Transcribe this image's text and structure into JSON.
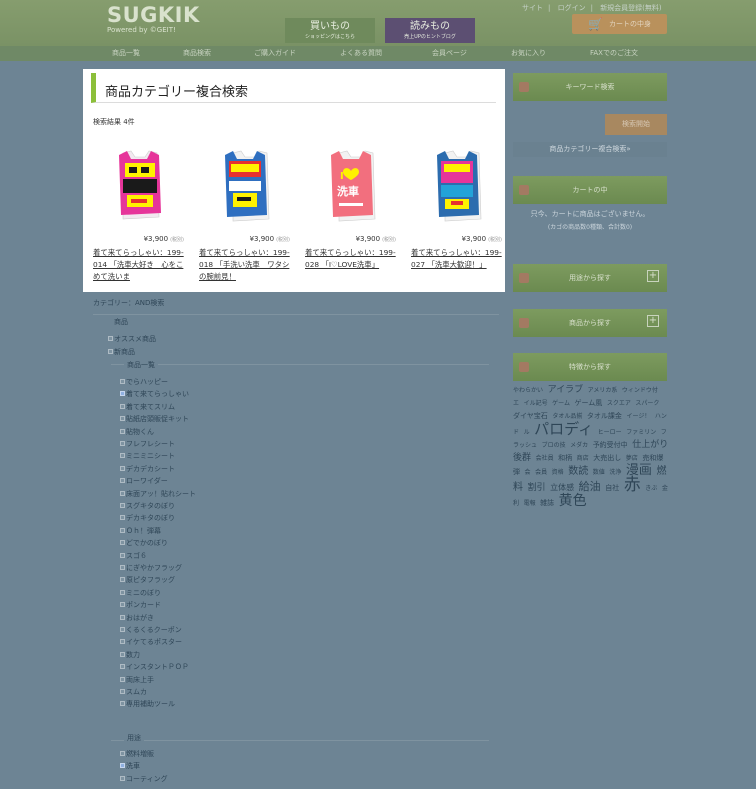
{
  "header": {
    "logo": "SUGKIK",
    "logo_sub": "Powered by ©GEIT!",
    "buy_label": "買いもの",
    "buy_sub": "ショッピングはこちら",
    "read_label": "読みもの",
    "read_sub": "売上UPのヒントブログ",
    "toplinks": [
      "サイト",
      "ログイン",
      "新規会員登録(無料)"
    ],
    "cart_label": "カートの中身"
  },
  "nav": [
    "商品一覧",
    "商品検索",
    "ご購入ガイド",
    "よくある質問",
    "会員ページ",
    "お気に入り",
    "FAXでのご注文"
  ],
  "main": {
    "title": "商品カテゴリー複合検索",
    "count": "検索結果 4件",
    "products": [
      {
        "price": "¥3,900",
        "tax": "(税別)",
        "name": "着て来てらっしゃい：199-014 「洗車大好き　心をこめて洗いま"
      },
      {
        "price": "¥3,900",
        "tax": "(税別)",
        "name": "着て来てらっしゃい：199-018 「手洗い洗車　ワタシの腕前見！"
      },
      {
        "price": "¥3,900",
        "tax": "(税別)",
        "name": "着て来てらっしゃい：199-028 「I♡LOVE洗車」"
      },
      {
        "price": "¥3,900",
        "tax": "(税別)",
        "name": "着て来てらっしゃい：199-027 「洗車大歓迎！」"
      }
    ]
  },
  "filter": {
    "category_label": "カテゴリー：AND検索",
    "group1": "商品",
    "top_items": [
      {
        "label": "オススメ商品",
        "checked": false
      },
      {
        "label": "新商品",
        "checked": false
      }
    ],
    "subgroup": "商品一覧",
    "items": [
      {
        "label": "でらハッピー",
        "checked": false
      },
      {
        "label": "着て来てらっしゃい",
        "checked": true
      },
      {
        "label": "着て来てスリム",
        "checked": false
      },
      {
        "label": "貼紙店頭販促キット",
        "checked": false
      },
      {
        "label": "貼物くん",
        "checked": false
      },
      {
        "label": "フレフレシート",
        "checked": false
      },
      {
        "label": "ミニミニシート",
        "checked": false
      },
      {
        "label": "デカデカシート",
        "checked": false
      },
      {
        "label": "ローワイダー",
        "checked": false
      },
      {
        "label": "床面アッ！貼れシート",
        "checked": false
      },
      {
        "label": "スグキタのぼり",
        "checked": false
      },
      {
        "label": "デカキタのぼり",
        "checked": false
      },
      {
        "label": "Ｏｈ！弾幕",
        "checked": false
      },
      {
        "label": "どでかのぼり",
        "checked": false
      },
      {
        "label": "スゴ６",
        "checked": false
      },
      {
        "label": "にぎやかフラッグ",
        "checked": false
      },
      {
        "label": "原ピタフラッグ",
        "checked": false
      },
      {
        "label": "ミニのぼり",
        "checked": false
      },
      {
        "label": "ポンカード",
        "checked": false
      },
      {
        "label": "おはがき",
        "checked": false
      },
      {
        "label": "くるくるクーポン",
        "checked": false
      },
      {
        "label": "イケてるポスター",
        "checked": false
      },
      {
        "label": "数力",
        "checked": false
      },
      {
        "label": "インスタントＰＯＰ",
        "checked": false
      },
      {
        "label": "両床上手",
        "checked": false
      },
      {
        "label": "スムカ",
        "checked": false
      },
      {
        "label": "専用補助ツール",
        "checked": false
      }
    ],
    "group2": "用途",
    "items2": [
      {
        "label": "燃料増販",
        "checked": false
      },
      {
        "label": "洗車",
        "checked": true
      },
      {
        "label": "コーティング",
        "checked": false
      }
    ]
  },
  "sidebar": {
    "keyword": "キーワード検索",
    "search_btn": "検索開始",
    "advanced": "商品カテゴリー複合検索»",
    "cart": "カートの中",
    "cart_empty": "只今、カートに商品はございません。",
    "cart_note": "(カゴの商品数0種類、合計数0)",
    "use_search": "用途から探す",
    "product_search": "商品から探す",
    "feature_search": "特徴から探す",
    "plus": "+",
    "tags": [
      {
        "t": "やわらかい",
        "s": 6
      },
      {
        "t": "アイラブ",
        "s": 9
      },
      {
        "t": "アメリカ系",
        "s": 6
      },
      {
        "t": "ウィンドウ付",
        "s": 6
      },
      {
        "t": "エ",
        "s": 6
      },
      {
        "t": "イル記号",
        "s": 6
      },
      {
        "t": "ゲーム",
        "s": 6
      },
      {
        "t": "ゲーム風",
        "s": 7
      },
      {
        "t": "スクエア",
        "s": 6
      },
      {
        "t": "スパーク",
        "s": 6
      },
      {
        "t": "ダイヤ宝石",
        "s": 7
      },
      {
        "t": "タオル品揃",
        "s": 6
      },
      {
        "t": "タオル課金",
        "s": 7
      },
      {
        "t": "イージ！",
        "s": 6
      },
      {
        "t": "ハンド",
        "s": 6
      },
      {
        "t": "ル",
        "s": 6
      },
      {
        "t": "パロディ",
        "s": 15
      },
      {
        "t": "ヒーロー",
        "s": 6
      },
      {
        "t": "ファミリン",
        "s": 6
      },
      {
        "t": "フラッシュ",
        "s": 6
      },
      {
        "t": "ブロの技",
        "s": 6
      },
      {
        "t": "メダカ",
        "s": 6
      },
      {
        "t": "予約受付中",
        "s": 7
      },
      {
        "t": "仕上がり後群",
        "s": 9
      },
      {
        "t": "会社員",
        "s": 6
      },
      {
        "t": "和柄",
        "s": 7
      },
      {
        "t": "商店",
        "s": 6
      },
      {
        "t": "大売出し",
        "s": 7
      },
      {
        "t": "夢店",
        "s": 6
      },
      {
        "t": "売和爆弾",
        "s": 7
      },
      {
        "t": "会",
        "s": 6
      },
      {
        "t": "会員",
        "s": 6
      },
      {
        "t": "資格",
        "s": 6
      },
      {
        "t": "数読",
        "s": 10
      },
      {
        "t": "数値",
        "s": 6
      },
      {
        "t": "洗浄",
        "s": 6
      },
      {
        "t": "漫画",
        "s": 13
      },
      {
        "t": "燃料",
        "s": 10
      },
      {
        "t": "割引",
        "s": 9
      },
      {
        "t": "立体感",
        "s": 8
      },
      {
        "t": "給油",
        "s": 11
      },
      {
        "t": "自社",
        "s": 7
      },
      {
        "t": "赤",
        "s": 17
      },
      {
        "t": "きぶ",
        "s": 6
      },
      {
        "t": "金利",
        "s": 6
      },
      {
        "t": "電報",
        "s": 6
      },
      {
        "t": "雑誌",
        "s": 7
      },
      {
        "t": "黄色",
        "s": 14
      }
    ]
  },
  "colors": {
    "accent": "#8cbf3a",
    "header": "#7a9265",
    "page": "#6d8494"
  }
}
